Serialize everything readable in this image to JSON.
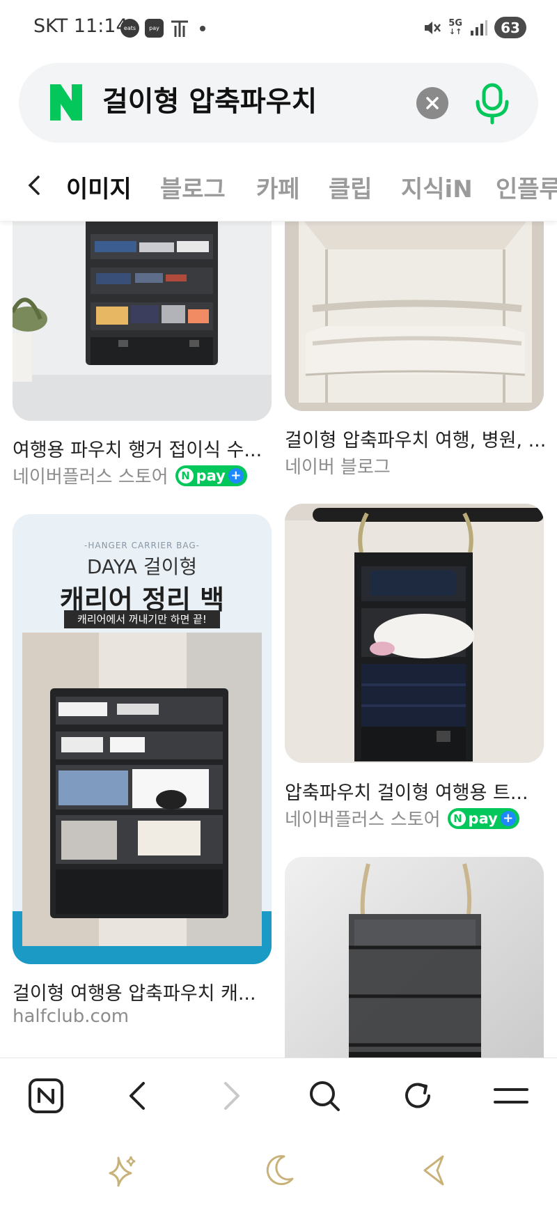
{
  "status_bar": {
    "carrier": "SKT",
    "time": "11:14",
    "notif_icons": [
      "coupang-eats-icon",
      "pay-app-icon",
      "t-icon",
      "dot-icon"
    ],
    "coupang_label": "eats",
    "pay_label": "pay",
    "network": "5G",
    "battery": "63"
  },
  "search": {
    "query": "걸이형 압축파우치"
  },
  "tabs": [
    "이미지",
    "블로그",
    "카페",
    "클립",
    "지식iN",
    "인플루"
  ],
  "results": [
    {
      "caption": "여행용 파우치 행거 접이식 수...",
      "source": "네이버플러스 스토어",
      "npay": true
    },
    {
      "caption": "걸이형 압축파우치 여행, 병원, ...",
      "source": "네이버 블로그",
      "npay": false
    },
    {
      "caption": "걸이형 여행용 압축파우치 캐...",
      "source": "halfclub.com",
      "npay": false,
      "banner": {
        "eyebrow": "-HANGER CARRIER BAG-",
        "brand": "DAYA 걸이형",
        "headline": "캐리어 정리 백",
        "subline": "캐리어에서 꺼내기만 하면 끝!"
      }
    },
    {
      "caption": "압축파우치 걸이형 여행용 트...",
      "source": "네이버플러스 스토어",
      "npay": true
    },
    {
      "caption": "",
      "source": "",
      "npay": false
    }
  ],
  "npay_label": "pay",
  "colors": {
    "naver_green": "#03c75a",
    "npay_plus": "#1e88ff",
    "search_bg": "#f2f4f5"
  },
  "bottom_nav": [
    "naver-home-icon",
    "back-icon",
    "forward-icon",
    "search-icon",
    "refresh-icon",
    "menu-icon"
  ],
  "system_nav": [
    "sparkle-icon",
    "moon-icon",
    "back-triangle-icon"
  ]
}
